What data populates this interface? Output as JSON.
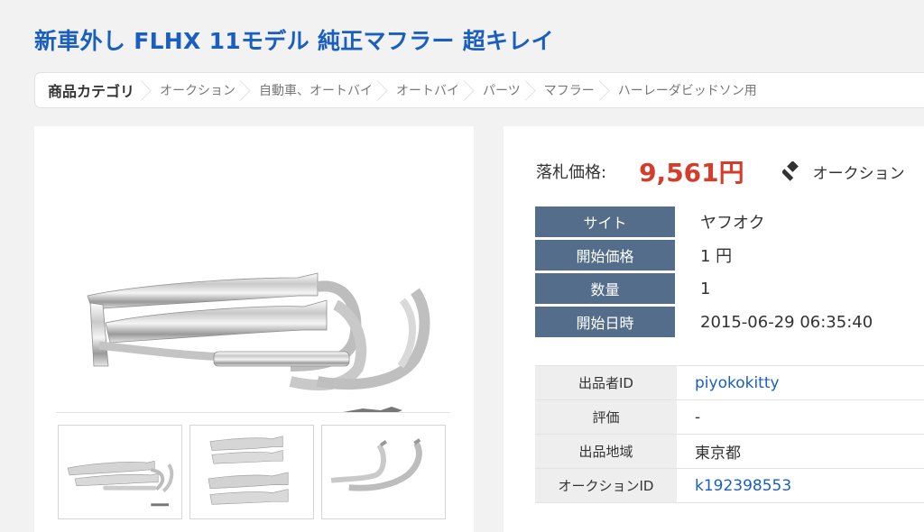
{
  "title": "新車外し FLHX 11モデル 純正マフラー 超キレイ",
  "breadcrumb": [
    "商品カテゴリ",
    "オークション",
    "自動車、オートバイ",
    "オートバイ",
    "パーツ",
    "マフラー",
    "ハーレーダビッドソン用"
  ],
  "price": {
    "label": "落札価格:",
    "value": "9,561円",
    "auction_link": "オークション",
    "auction_icon": "gavel-icon"
  },
  "info": [
    {
      "label": "サイト",
      "value": "ヤフオク"
    },
    {
      "label": "開始価格",
      "value": "1 円"
    },
    {
      "label": "数量",
      "value": "1"
    },
    {
      "label": "開始日時",
      "value": "2015-06-29 06:35:40"
    }
  ],
  "seller": [
    {
      "label": "出品者ID",
      "value": "piyokokitty"
    },
    {
      "label": "評価",
      "value": "-"
    },
    {
      "label": "出品地域",
      "value": "東京都"
    },
    {
      "label": "オークションID",
      "value": "k192398553"
    }
  ],
  "colors": {
    "title": "#1a5fc0",
    "price": "#d53c2a",
    "header": "#536d8b",
    "link": "#1a5fc0"
  }
}
